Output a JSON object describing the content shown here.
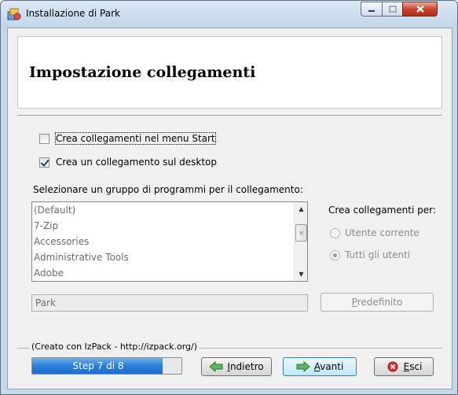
{
  "window": {
    "title": "Installazione di  Park"
  },
  "header": {
    "title": "Impostazione collegamenti"
  },
  "options": {
    "start_menu": {
      "label": "Crea collegamenti nel menu Start",
      "checked": false
    },
    "desktop": {
      "label": "Crea un collegamento sul desktop",
      "checked": true
    }
  },
  "program_group": {
    "label": "Selezionare un gruppo di programmi per il collegamento:",
    "items": [
      "(Default)",
      "7-Zip",
      "Accessories",
      "Administrative Tools",
      "Adobe"
    ],
    "value": "Park"
  },
  "shortcuts_for": {
    "label": "Crea collegamenti per:",
    "options": [
      {
        "label": "Utente corrente",
        "selected": false
      },
      {
        "label": "Tutti gli utenti",
        "selected": true
      }
    ]
  },
  "buttons": {
    "default": "Predefinito",
    "back": "Indietro",
    "next": "Avanti",
    "exit": "Esci"
  },
  "footer": {
    "credit": "(Creato con IzPack - http://izpack.org/)"
  },
  "progress": {
    "label": "Step 7 di 8",
    "fraction": 0.875
  }
}
